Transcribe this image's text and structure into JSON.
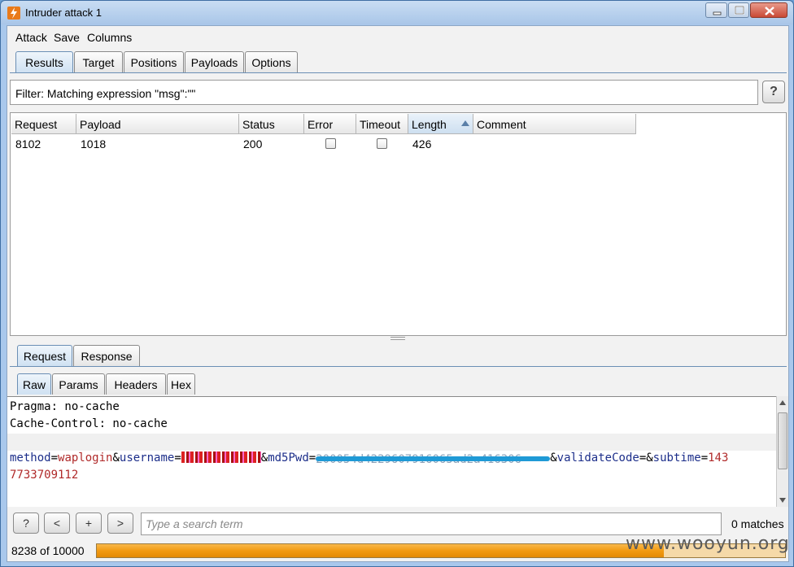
{
  "window": {
    "title": "Intruder attack 1"
  },
  "menu": {
    "items": [
      "Attack",
      "Save",
      "Columns"
    ]
  },
  "main_tabs": [
    "Results",
    "Target",
    "Positions",
    "Payloads",
    "Options"
  ],
  "filter": {
    "text": "Filter: Matching expression \"msg\":\"\"",
    "help_label": "?"
  },
  "table": {
    "columns": [
      "Request",
      "Payload",
      "Status",
      "Error",
      "Timeout",
      "Length",
      "Comment"
    ],
    "sorted_column": "Length",
    "rows": [
      {
        "request": "8102",
        "payload": "1018",
        "status": "200",
        "error": false,
        "timeout": false,
        "length": "426",
        "comment": ""
      }
    ]
  },
  "detail_tabs": [
    "Request",
    "Response"
  ],
  "view_tabs": [
    "Raw",
    "Params",
    "Headers",
    "Hex"
  ],
  "editor": {
    "line1": "Pragma: no-cache",
    "line2": "Cache-Control: no-cache",
    "body": {
      "k_method": "method",
      "v_method": "waplogin",
      "k_username": "username",
      "k_md5": "md5Pwd",
      "v_md5_visible": "200054d4229607916065ad2a416306",
      "k_validate": "validateCode",
      "k_subtime": "subtime",
      "v_subtime_part1": "143",
      "v_subtime_part2": "7733709112"
    }
  },
  "search": {
    "help_label": "?",
    "prev_label": "<",
    "add_label": "+",
    "next_label": ">",
    "placeholder": "Type a search term",
    "matches": "0 matches"
  },
  "status": {
    "progress_text": "8238 of 10000",
    "progress_fraction": 0.8238,
    "watermark": "www.wooyun.org"
  },
  "colors": {
    "accent_tab": "#cfe1f2",
    "progress": "#f29a12",
    "param_key": "#1c2e8a",
    "param_value": "#b02a2a"
  }
}
